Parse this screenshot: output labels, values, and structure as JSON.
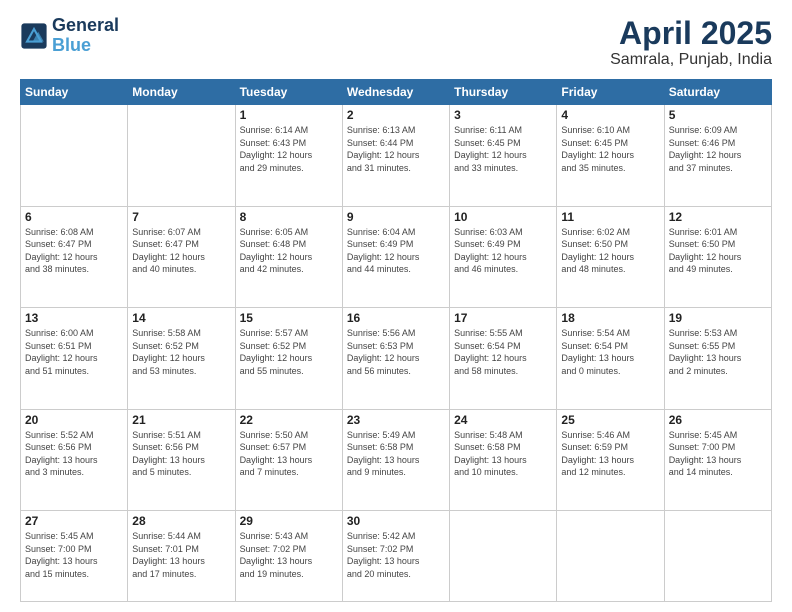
{
  "logo": {
    "line1": "General",
    "line2": "Blue"
  },
  "title": "April 2025",
  "subtitle": "Samrala, Punjab, India",
  "weekdays": [
    "Sunday",
    "Monday",
    "Tuesday",
    "Wednesday",
    "Thursday",
    "Friday",
    "Saturday"
  ],
  "weeks": [
    [
      {
        "day": "",
        "info": ""
      },
      {
        "day": "",
        "info": ""
      },
      {
        "day": "1",
        "info": "Sunrise: 6:14 AM\nSunset: 6:43 PM\nDaylight: 12 hours\nand 29 minutes."
      },
      {
        "day": "2",
        "info": "Sunrise: 6:13 AM\nSunset: 6:44 PM\nDaylight: 12 hours\nand 31 minutes."
      },
      {
        "day": "3",
        "info": "Sunrise: 6:11 AM\nSunset: 6:45 PM\nDaylight: 12 hours\nand 33 minutes."
      },
      {
        "day": "4",
        "info": "Sunrise: 6:10 AM\nSunset: 6:45 PM\nDaylight: 12 hours\nand 35 minutes."
      },
      {
        "day": "5",
        "info": "Sunrise: 6:09 AM\nSunset: 6:46 PM\nDaylight: 12 hours\nand 37 minutes."
      }
    ],
    [
      {
        "day": "6",
        "info": "Sunrise: 6:08 AM\nSunset: 6:47 PM\nDaylight: 12 hours\nand 38 minutes."
      },
      {
        "day": "7",
        "info": "Sunrise: 6:07 AM\nSunset: 6:47 PM\nDaylight: 12 hours\nand 40 minutes."
      },
      {
        "day": "8",
        "info": "Sunrise: 6:05 AM\nSunset: 6:48 PM\nDaylight: 12 hours\nand 42 minutes."
      },
      {
        "day": "9",
        "info": "Sunrise: 6:04 AM\nSunset: 6:49 PM\nDaylight: 12 hours\nand 44 minutes."
      },
      {
        "day": "10",
        "info": "Sunrise: 6:03 AM\nSunset: 6:49 PM\nDaylight: 12 hours\nand 46 minutes."
      },
      {
        "day": "11",
        "info": "Sunrise: 6:02 AM\nSunset: 6:50 PM\nDaylight: 12 hours\nand 48 minutes."
      },
      {
        "day": "12",
        "info": "Sunrise: 6:01 AM\nSunset: 6:50 PM\nDaylight: 12 hours\nand 49 minutes."
      }
    ],
    [
      {
        "day": "13",
        "info": "Sunrise: 6:00 AM\nSunset: 6:51 PM\nDaylight: 12 hours\nand 51 minutes."
      },
      {
        "day": "14",
        "info": "Sunrise: 5:58 AM\nSunset: 6:52 PM\nDaylight: 12 hours\nand 53 minutes."
      },
      {
        "day": "15",
        "info": "Sunrise: 5:57 AM\nSunset: 6:52 PM\nDaylight: 12 hours\nand 55 minutes."
      },
      {
        "day": "16",
        "info": "Sunrise: 5:56 AM\nSunset: 6:53 PM\nDaylight: 12 hours\nand 56 minutes."
      },
      {
        "day": "17",
        "info": "Sunrise: 5:55 AM\nSunset: 6:54 PM\nDaylight: 12 hours\nand 58 minutes."
      },
      {
        "day": "18",
        "info": "Sunrise: 5:54 AM\nSunset: 6:54 PM\nDaylight: 13 hours\nand 0 minutes."
      },
      {
        "day": "19",
        "info": "Sunrise: 5:53 AM\nSunset: 6:55 PM\nDaylight: 13 hours\nand 2 minutes."
      }
    ],
    [
      {
        "day": "20",
        "info": "Sunrise: 5:52 AM\nSunset: 6:56 PM\nDaylight: 13 hours\nand 3 minutes."
      },
      {
        "day": "21",
        "info": "Sunrise: 5:51 AM\nSunset: 6:56 PM\nDaylight: 13 hours\nand 5 minutes."
      },
      {
        "day": "22",
        "info": "Sunrise: 5:50 AM\nSunset: 6:57 PM\nDaylight: 13 hours\nand 7 minutes."
      },
      {
        "day": "23",
        "info": "Sunrise: 5:49 AM\nSunset: 6:58 PM\nDaylight: 13 hours\nand 9 minutes."
      },
      {
        "day": "24",
        "info": "Sunrise: 5:48 AM\nSunset: 6:58 PM\nDaylight: 13 hours\nand 10 minutes."
      },
      {
        "day": "25",
        "info": "Sunrise: 5:46 AM\nSunset: 6:59 PM\nDaylight: 13 hours\nand 12 minutes."
      },
      {
        "day": "26",
        "info": "Sunrise: 5:45 AM\nSunset: 7:00 PM\nDaylight: 13 hours\nand 14 minutes."
      }
    ],
    [
      {
        "day": "27",
        "info": "Sunrise: 5:45 AM\nSunset: 7:00 PM\nDaylight: 13 hours\nand 15 minutes."
      },
      {
        "day": "28",
        "info": "Sunrise: 5:44 AM\nSunset: 7:01 PM\nDaylight: 13 hours\nand 17 minutes."
      },
      {
        "day": "29",
        "info": "Sunrise: 5:43 AM\nSunset: 7:02 PM\nDaylight: 13 hours\nand 19 minutes."
      },
      {
        "day": "30",
        "info": "Sunrise: 5:42 AM\nSunset: 7:02 PM\nDaylight: 13 hours\nand 20 minutes."
      },
      {
        "day": "",
        "info": ""
      },
      {
        "day": "",
        "info": ""
      },
      {
        "day": "",
        "info": ""
      }
    ]
  ]
}
